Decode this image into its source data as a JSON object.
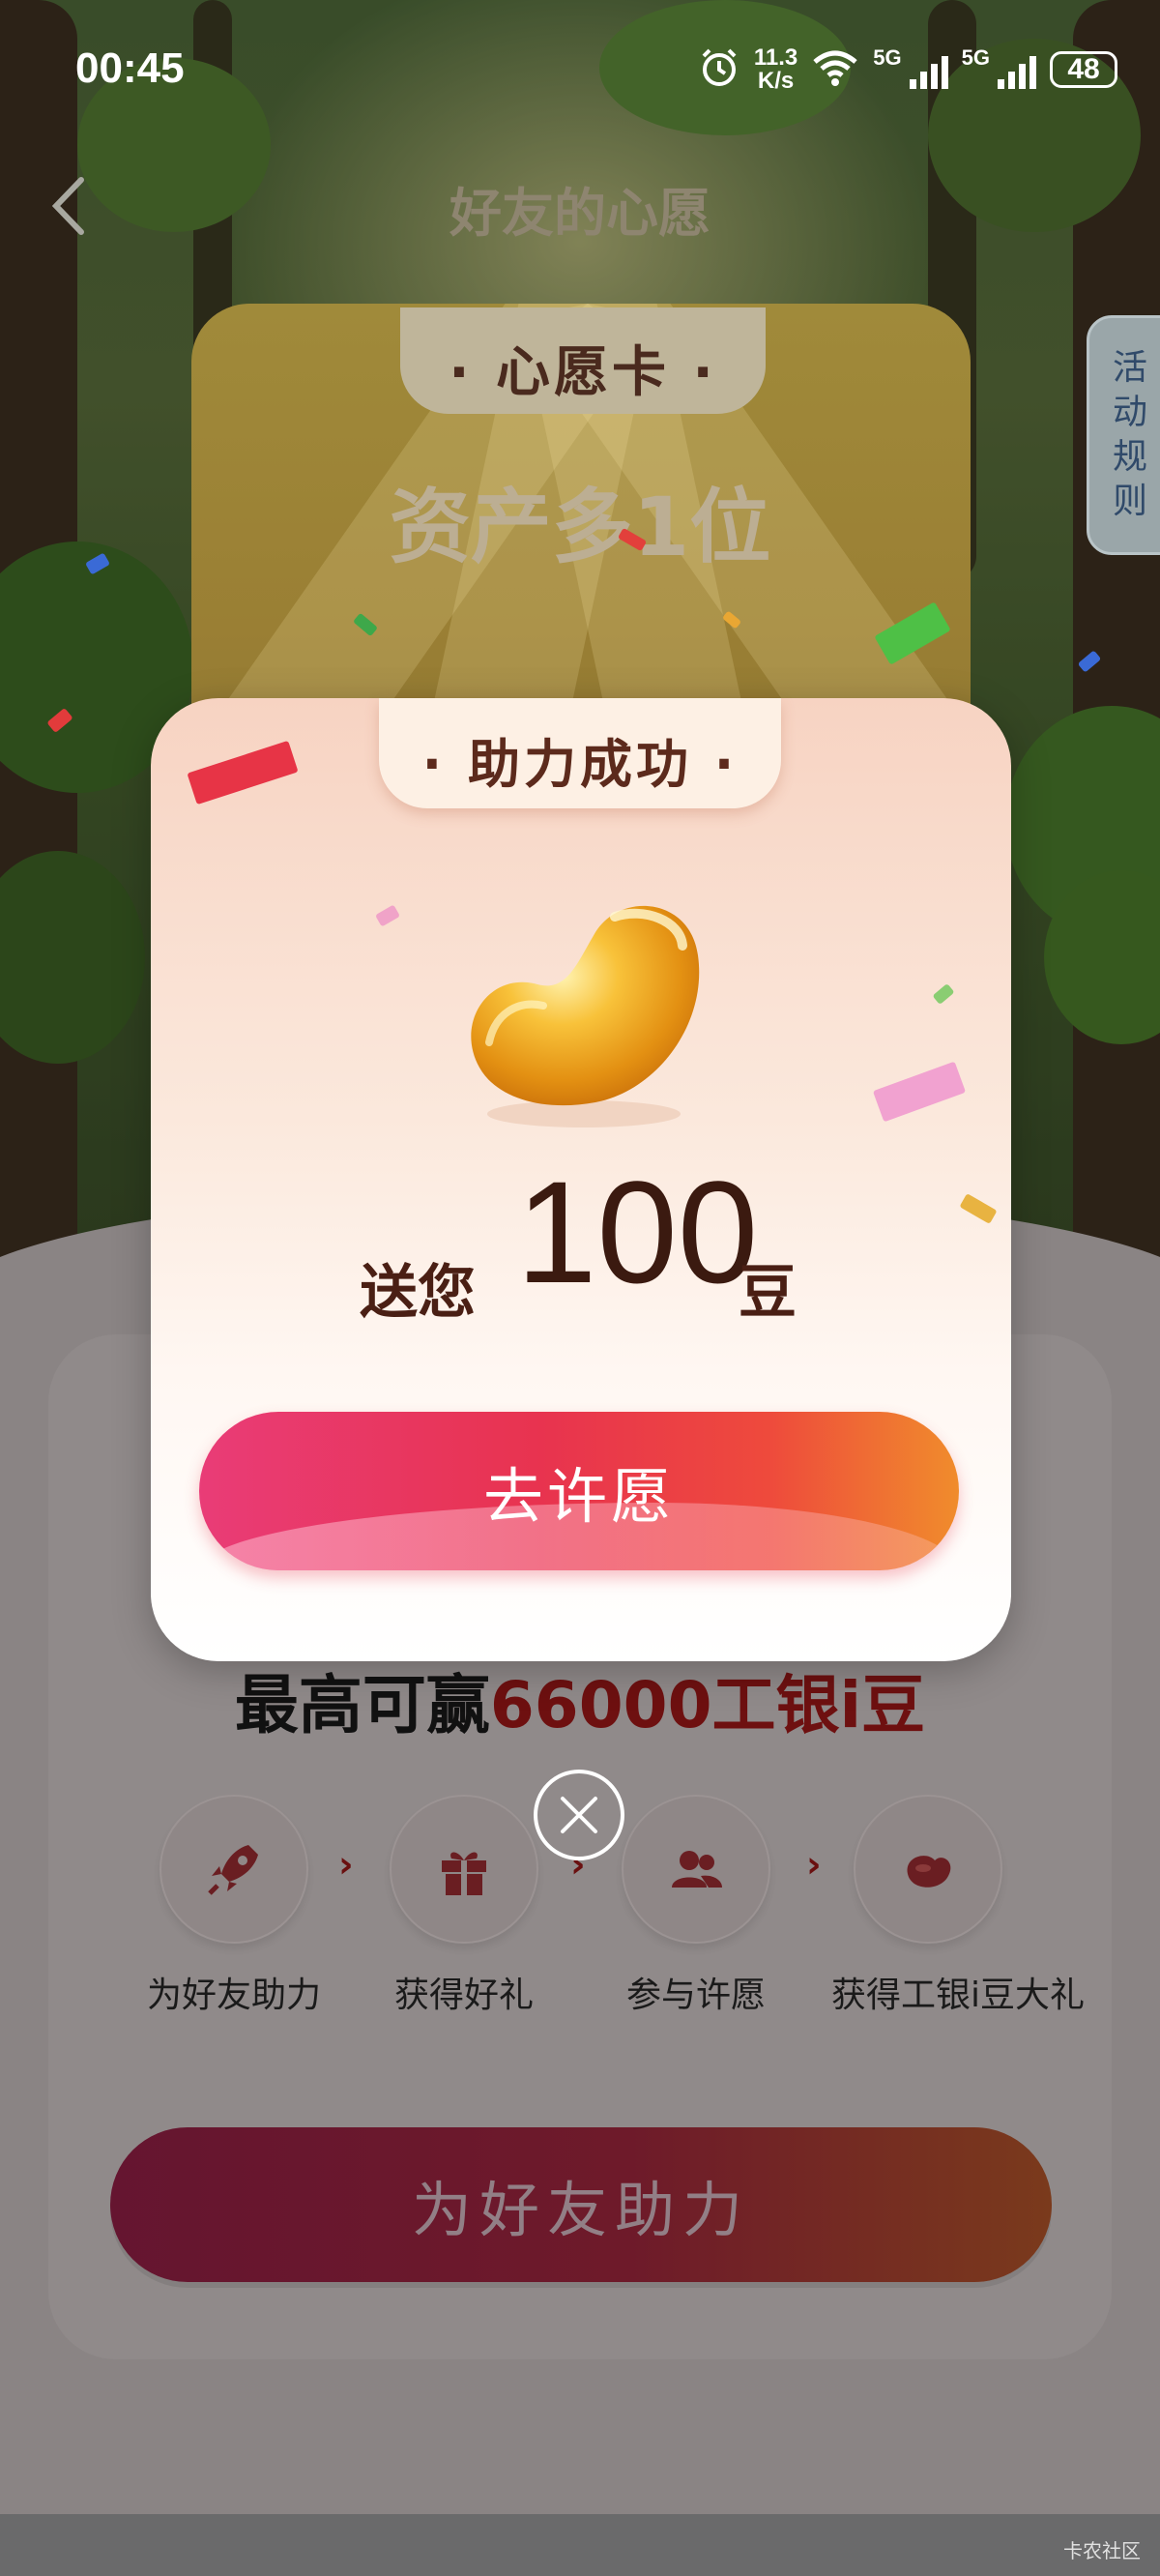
{
  "status_bar": {
    "time": "00:45",
    "speed_value": "11.3",
    "speed_unit": "K/s",
    "network1": "5G",
    "network2": "5G",
    "battery": "48"
  },
  "header": {
    "title": "好友的心愿",
    "rules_tab": [
      "活",
      "动",
      "规",
      "则"
    ]
  },
  "wish_card": {
    "tab_title": "· 心愿卡 ·",
    "subtitle": "资产多1位"
  },
  "modal": {
    "title": "· 助力成功 ·",
    "reward_prefix": "送您",
    "reward_amount": "100",
    "reward_unit": "豆",
    "button_label": "去许愿"
  },
  "main": {
    "reward_line_prefix": "最高可赢",
    "reward_line_highlight": "66000工银i豆",
    "steps": [
      {
        "label": "为好友助力",
        "icon": "rocket-icon"
      },
      {
        "label": "获得好礼",
        "icon": "gift-icon"
      },
      {
        "label": "参与许愿",
        "icon": "people-icon"
      },
      {
        "label": "获得工银i豆大礼",
        "icon": "bean-icon"
      }
    ],
    "cta_label": "为好友助力"
  },
  "watermark": "卡农社区"
}
